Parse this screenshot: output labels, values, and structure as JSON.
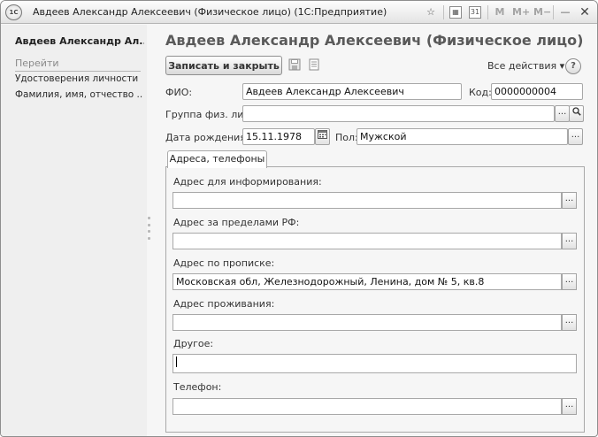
{
  "window": {
    "title": "Авдеев Александр Алексеевич (Физическое лицо)",
    "app_suffix": "(1С:Предприятие)",
    "logo_text": "1С",
    "tools": {
      "star": "☆",
      "calc": "▦",
      "calendar": "31",
      "mem_m": "M",
      "mem_mplus": "M+",
      "mem_mminus": "M−",
      "minimize": "—",
      "close": "✕"
    }
  },
  "sidebar": {
    "title": "Авдеев Александр Ал...",
    "nav_header": "Перейти",
    "items": [
      {
        "label": "Удостоверения личности"
      },
      {
        "label": "Фамилия, имя, отчество ..."
      }
    ]
  },
  "form": {
    "title": "Авдеев Александр Алексеевич (Физическое лицо)",
    "toolbar": {
      "save_close_label": "Записать и закрыть",
      "all_actions_label": "Все действия ▾",
      "help_label": "?"
    },
    "fio": {
      "label": "ФИО:",
      "value": "Авдеев Александр Алексеевич"
    },
    "code": {
      "label": "Код:",
      "value": "0000000004"
    },
    "group": {
      "label": "Группа физ. лиц:",
      "value": ""
    },
    "birth": {
      "label": "Дата рождения:",
      "value": "15.11.1978"
    },
    "gender": {
      "label": "Пол:",
      "value": "Мужской"
    },
    "ellipsis": "...",
    "tab": {
      "label": "Адреса, телефоны",
      "fields": [
        {
          "label": "Адрес для информирования:",
          "value": ""
        },
        {
          "label": "Адрес за пределами РФ:",
          "value": ""
        },
        {
          "label": "Адрес по прописке:",
          "value": "Московская обл, Железнодорожный, Ленина, дом № 5, кв.8"
        },
        {
          "label": "Адрес проживания:",
          "value": ""
        },
        {
          "label": "Другое:",
          "value": ""
        },
        {
          "label": "Телефон:",
          "value": ""
        }
      ]
    }
  },
  "colors": {
    "title_text": "#5a5a5a",
    "panel_bg": "#efefef",
    "form_bg": "#f6f6f6",
    "border": "#a8a8a8"
  }
}
